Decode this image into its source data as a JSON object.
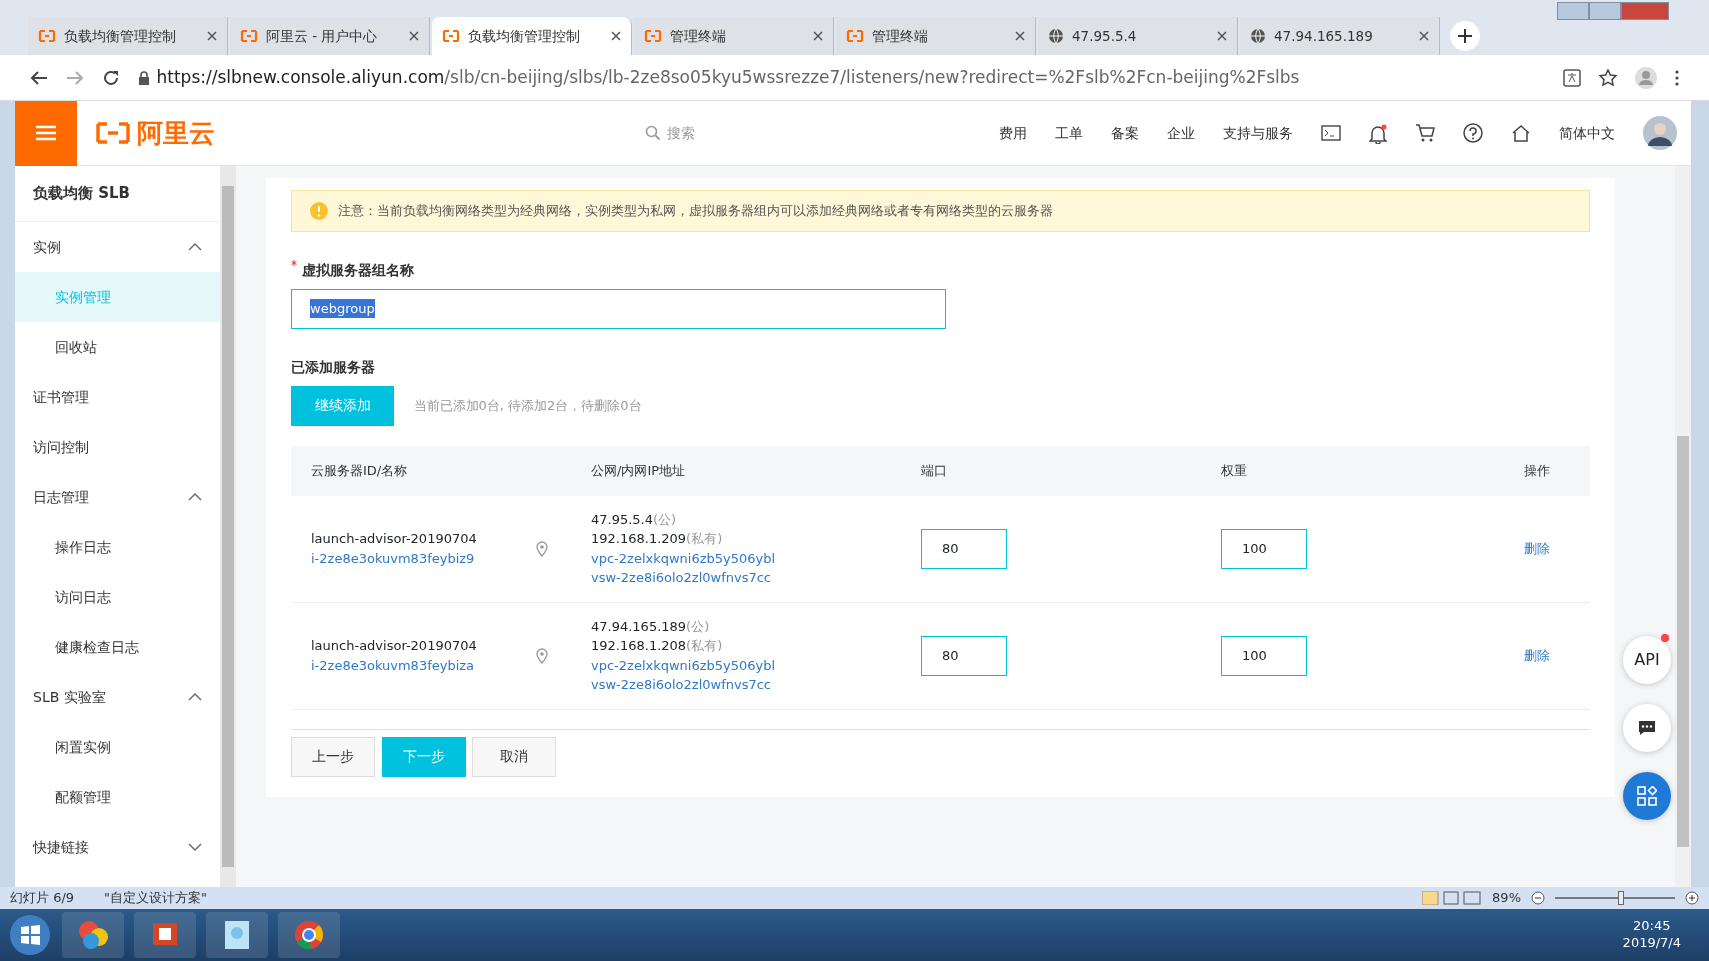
{
  "browser": {
    "tabs": [
      {
        "label": "负载均衡管理控制",
        "selected": false
      },
      {
        "label": "阿里云 - 用户中心",
        "selected": false
      },
      {
        "label": "负载均衡管理控制",
        "selected": true
      },
      {
        "label": "管理终端",
        "selected": false
      },
      {
        "label": "管理终端",
        "selected": false
      },
      {
        "label": "47.95.5.4",
        "selected": false
      },
      {
        "label": "47.94.165.189",
        "selected": false
      }
    ],
    "url_host": "https://slbnew.console.aliyun.com",
    "url_path": "/slb/cn-beijing/slbs/lb-2ze8so05kyu5wssrezze7/listeners/new?redirect=%2Fslb%2Fcn-beijing%2Fslbs"
  },
  "header": {
    "logo": "阿里云",
    "search_placeholder": "搜索",
    "nav": [
      "费用",
      "工单",
      "备案",
      "企业",
      "支持与服务"
    ],
    "language": "简体中文"
  },
  "sidebar": {
    "title": "负载均衡 SLB",
    "items": [
      {
        "kind": "group",
        "label": "实例",
        "expanded": true,
        "children": [
          {
            "label": "实例管理",
            "selected": true
          },
          {
            "label": "回收站",
            "selected": false
          }
        ]
      },
      {
        "kind": "link",
        "label": "证书管理"
      },
      {
        "kind": "link",
        "label": "访问控制"
      },
      {
        "kind": "group",
        "label": "日志管理",
        "expanded": true,
        "children": [
          {
            "label": "操作日志",
            "selected": false
          },
          {
            "label": "访问日志",
            "selected": false
          },
          {
            "label": "健康检查日志",
            "selected": false
          }
        ]
      },
      {
        "kind": "group",
        "label": "SLB 实验室",
        "expanded": true,
        "children": [
          {
            "label": "闲置实例",
            "selected": false
          },
          {
            "label": "配额管理",
            "selected": false
          }
        ]
      },
      {
        "kind": "group",
        "label": "快捷链接",
        "expanded": false
      }
    ]
  },
  "notice": "注意：当前负载均衡网络类型为经典网络，实例类型为私网，虚拟服务器组内可以添加经典网络或者专有网络类型的云服务器",
  "group_name": {
    "label": "虚拟服务器组名称",
    "required": true,
    "value": "webgroup"
  },
  "servers": {
    "heading": "已添加服务器",
    "add_button": "继续添加",
    "summary": "当前已添加0台, 待添加2台，待删除0台",
    "columns": [
      "云服务器ID/名称",
      "公网/内网IP地址",
      "端口",
      "权重",
      "操作"
    ],
    "rows": [
      {
        "name": "launch-advisor-20190704",
        "id": "i-2ze8e3okuvm83feybiz9",
        "public_ip": "47.95.5.4",
        "public_tag": "(公)",
        "private_ip": "192.168.1.209",
        "private_tag": "(私有)",
        "vpc": "vpc-2zelxkqwni6zb5y506ybl",
        "vsw": "vsw-2ze8i6olo2zl0wfnvs7cc",
        "port": "80",
        "weight": "100",
        "action": "删除"
      },
      {
        "name": "launch-advisor-20190704",
        "id": "i-2ze8e3okuvm83feybiza",
        "public_ip": "47.94.165.189",
        "public_tag": "(公)",
        "private_ip": "192.168.1.208",
        "private_tag": "(私有)",
        "vpc": "vpc-2zelxkqwni6zb5y506ybl",
        "vsw": "vsw-2ze8i6olo2zl0wfnvs7cc",
        "port": "80",
        "weight": "100",
        "action": "删除"
      }
    ]
  },
  "steps": [
    {
      "label": "上一步",
      "kind": "default"
    },
    {
      "label": "下一步",
      "kind": "primary"
    },
    {
      "label": "取消",
      "kind": "default"
    }
  ],
  "float_api": "API",
  "ppt_status": {
    "slide": "幻灯片 6/9",
    "theme": "\"自定义设计方案\"",
    "zoom": "89%",
    "level": 0.55
  },
  "taskbar": {
    "time": "20:45",
    "date": "2019/7/4"
  }
}
